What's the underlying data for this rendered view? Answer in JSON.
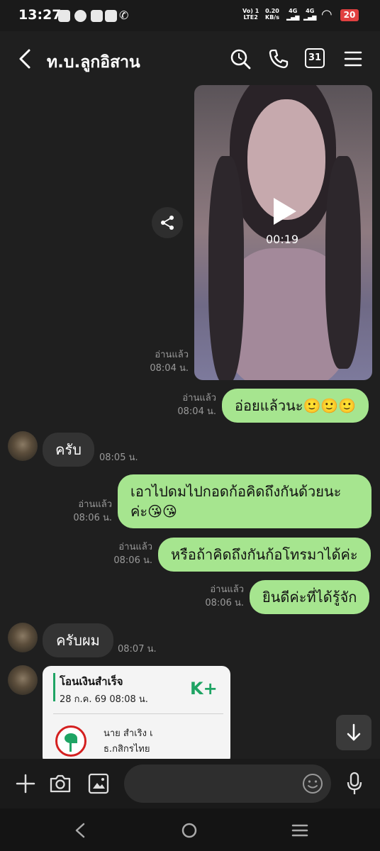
{
  "status": {
    "time": "13:27",
    "network_top": "Vo) 1",
    "network_bottom": "LTE2",
    "speed_top": "0.20",
    "speed_bottom": "KB/s",
    "sig1": "4G",
    "sig2": "4G",
    "battery": "20"
  },
  "header": {
    "title": "ท.บ.ลูกอิสาน",
    "calendar_day": "31"
  },
  "video": {
    "duration": "00:19",
    "read_label": "อ่านแล้ว",
    "time": "08:04 น."
  },
  "messages": [
    {
      "text": "อ่อยแล้วนะ🙂🙂🙂",
      "read": "อ่านแล้ว",
      "time": "08:04 น."
    },
    {
      "text": "ครับ",
      "time": "08:05 น."
    },
    {
      "line1": "เอาไปดมไปกอดก้อคิดถึงกันด้วยนะ",
      "line2": "ค่ะ😘😘",
      "read": "อ่านแล้ว",
      "time": "08:06 น."
    },
    {
      "text": "หรือถ้าคิดถึงกันก้อโทรมาได้ค่ะ",
      "read": "อ่านแล้ว",
      "time": "08:06 น."
    },
    {
      "text": "ยินดีค่ะที่ได้รู้จัก",
      "read": "อ่านแล้ว",
      "time": "08:06 น."
    },
    {
      "text": "ครับผม",
      "time": "08:07 น."
    }
  ],
  "transfer_card": {
    "title": "โอนเงินสำเร็จ",
    "datetime": "28 ก.ค. 69  08:08 น.",
    "logo": "K+",
    "name": "นาย สำเริง เ",
    "bank": "ธ.กสิกรไทย"
  },
  "colors": {
    "outgoing_bubble": "#a6e58f",
    "incoming_bubble": "#333333",
    "background": "#1f1f1f",
    "accent_green": "#1fa464"
  }
}
